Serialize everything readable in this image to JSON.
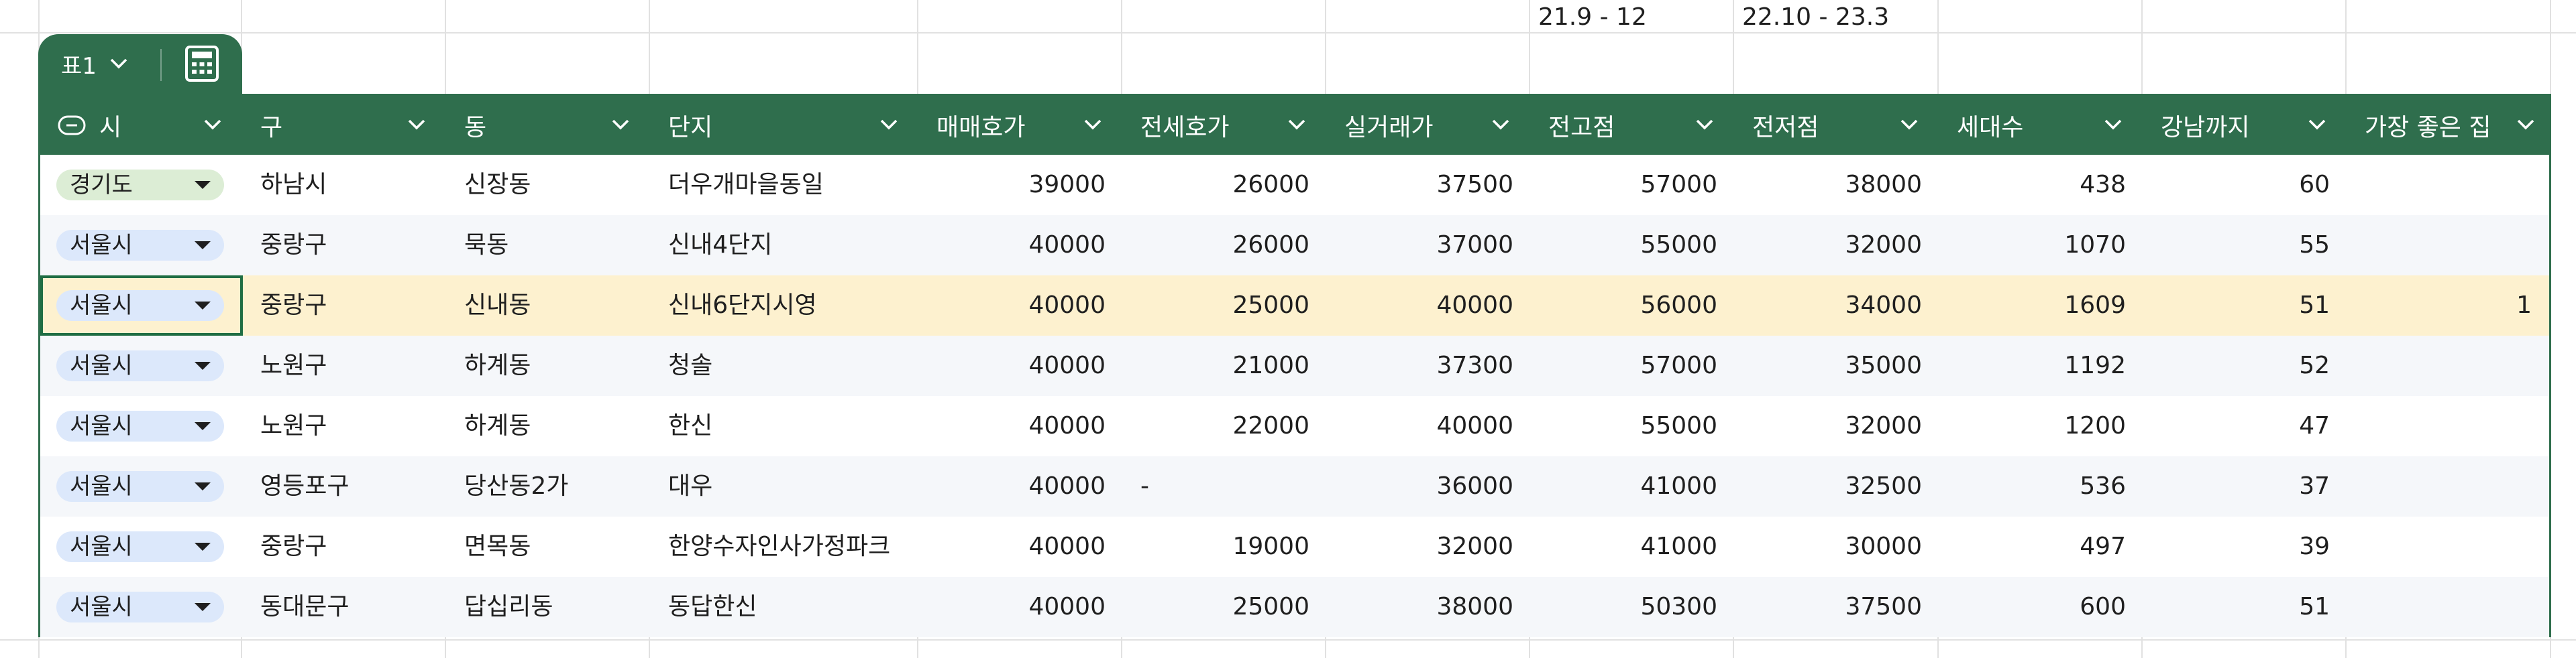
{
  "above_labels": {
    "col_prev_high_note": "21.9 - 12",
    "col_prev_low_note": "22.10 - 23.3"
  },
  "table_tab": {
    "name": "표1"
  },
  "columns": [
    {
      "label": "시"
    },
    {
      "label": "구"
    },
    {
      "label": "동"
    },
    {
      "label": "단지"
    },
    {
      "label": "매매호가"
    },
    {
      "label": "전세호가"
    },
    {
      "label": "실거래가"
    },
    {
      "label": "전고점"
    },
    {
      "label": "전저점"
    },
    {
      "label": "세대수"
    },
    {
      "label": "강남까지"
    },
    {
      "label": "가장 좋은 집"
    }
  ],
  "rows": [
    {
      "city": "경기도",
      "city_color": "#dcedd5",
      "gu": "하남시",
      "dong": "신장동",
      "complex": "더우개마을동일",
      "sale_price": "39000",
      "jeonse_price": "26000",
      "actual_price": "37500",
      "prev_high": "57000",
      "prev_low": "38000",
      "households": "438",
      "to_gangnam": "60",
      "best_home": ""
    },
    {
      "city": "서울시",
      "city_color": "#dce8fb",
      "gu": "중랑구",
      "dong": "묵동",
      "complex": "신내4단지",
      "sale_price": "40000",
      "jeonse_price": "26000",
      "actual_price": "37000",
      "prev_high": "55000",
      "prev_low": "32000",
      "households": "1070",
      "to_gangnam": "55",
      "best_home": ""
    },
    {
      "city": "서울시",
      "city_color": "#dce8fb",
      "gu": "중랑구",
      "dong": "신내동",
      "complex": "신내6단지시영",
      "sale_price": "40000",
      "jeonse_price": "25000",
      "actual_price": "40000",
      "prev_high": "56000",
      "prev_low": "34000",
      "households": "1609",
      "to_gangnam": "51",
      "best_home": "1"
    },
    {
      "city": "서울시",
      "city_color": "#dce8fb",
      "gu": "노원구",
      "dong": "하계동",
      "complex": "청솔",
      "sale_price": "40000",
      "jeonse_price": "21000",
      "actual_price": "37300",
      "prev_high": "57000",
      "prev_low": "35000",
      "households": "1192",
      "to_gangnam": "52",
      "best_home": ""
    },
    {
      "city": "서울시",
      "city_color": "#dce8fb",
      "gu": "노원구",
      "dong": "하계동",
      "complex": "한신",
      "sale_price": "40000",
      "jeonse_price": "22000",
      "actual_price": "40000",
      "prev_high": "55000",
      "prev_low": "32000",
      "households": "1200",
      "to_gangnam": "47",
      "best_home": ""
    },
    {
      "city": "서울시",
      "city_color": "#dce8fb",
      "gu": "영등포구",
      "dong": "당산동2가",
      "complex": "대우",
      "sale_price": "40000",
      "jeonse_price": "-",
      "actual_price": "36000",
      "prev_high": "41000",
      "prev_low": "32500",
      "households": "536",
      "to_gangnam": "37",
      "best_home": ""
    },
    {
      "city": "서울시",
      "city_color": "#dce8fb",
      "gu": "중랑구",
      "dong": "면목동",
      "complex": "한양수자인사가정파크",
      "sale_price": "40000",
      "jeonse_price": "19000",
      "actual_price": "32000",
      "prev_high": "41000",
      "prev_low": "30000",
      "households": "497",
      "to_gangnam": "39",
      "best_home": ""
    },
    {
      "city": "서울시",
      "city_color": "#dce8fb",
      "gu": "동대문구",
      "dong": "답십리동",
      "complex": "동답한신",
      "sale_price": "40000",
      "jeonse_price": "25000",
      "actual_price": "38000",
      "prev_high": "50300",
      "prev_low": "37500",
      "households": "600",
      "to_gangnam": "51",
      "best_home": ""
    }
  ],
  "selected_row_index": 2,
  "colors": {
    "header_bg": "#2f6e4d",
    "selected_row_bg": "#fdf1cf",
    "grid_line": "#e1e1e1"
  }
}
